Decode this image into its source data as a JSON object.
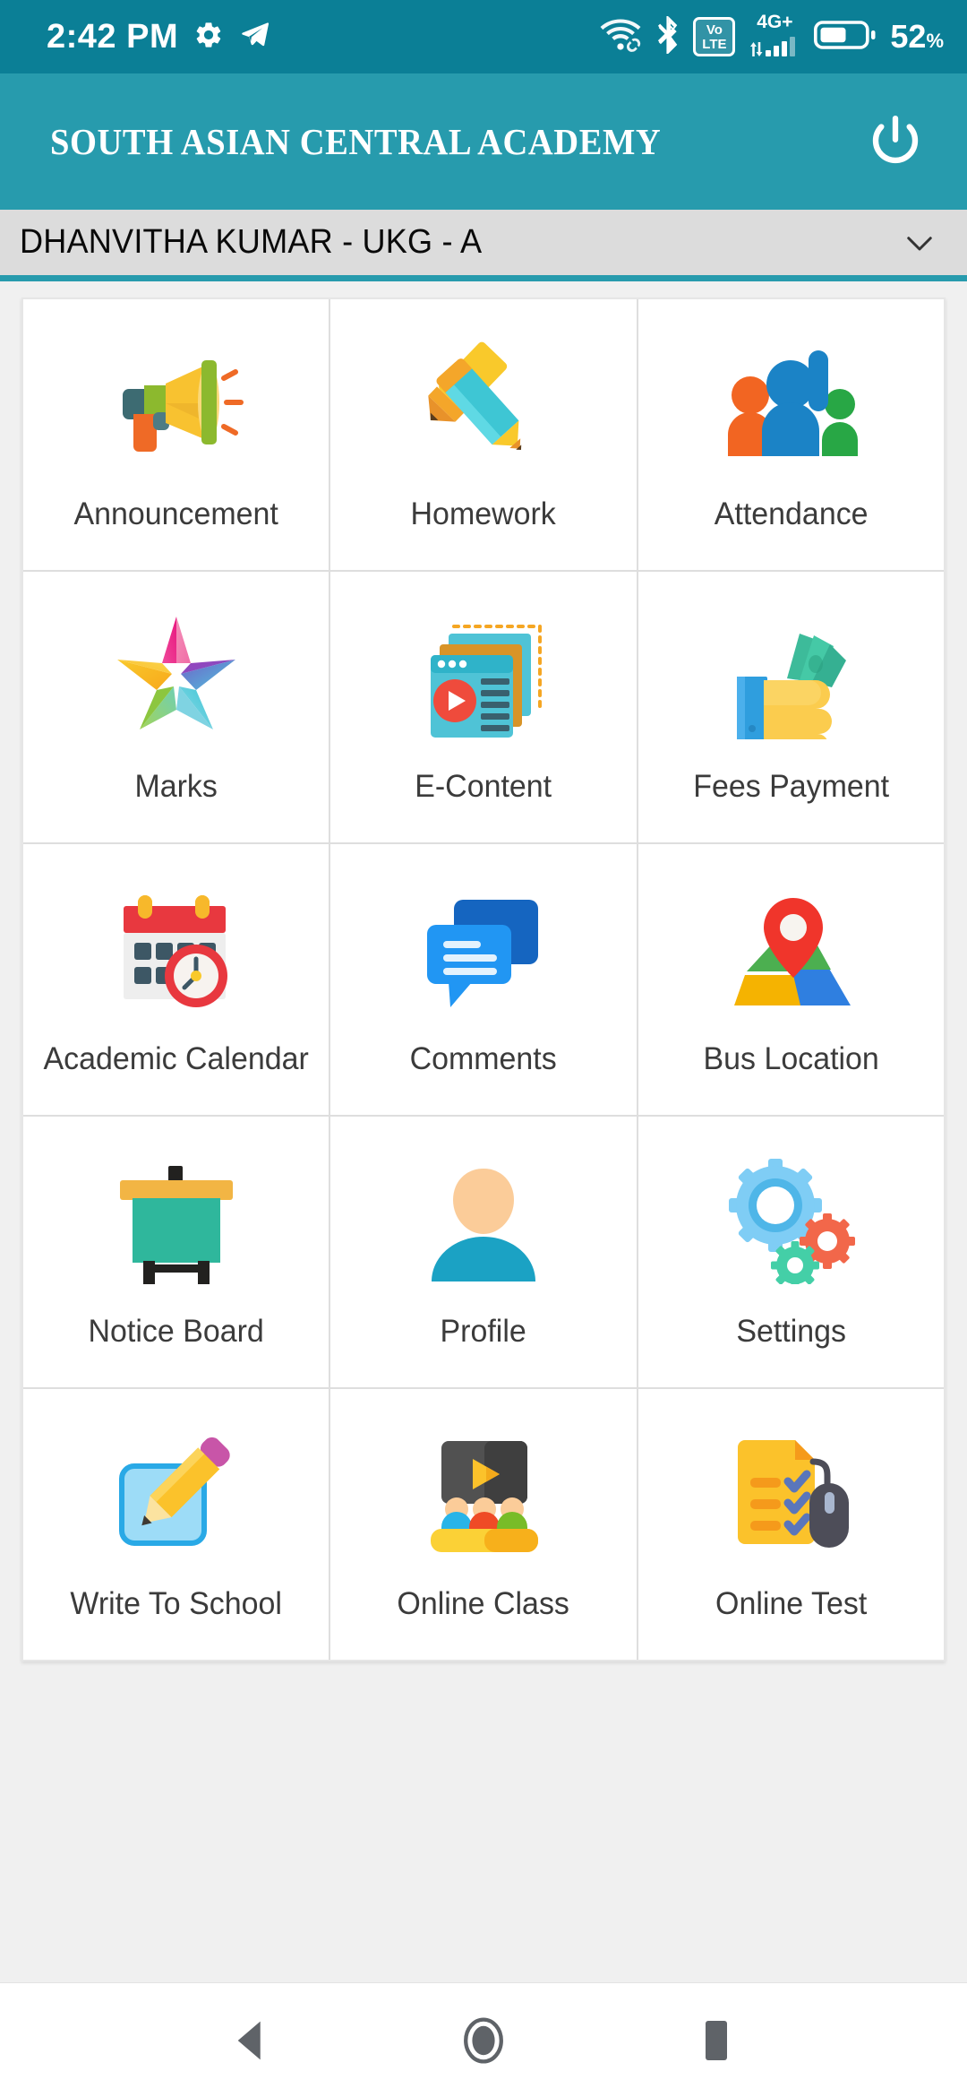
{
  "status_bar": {
    "time": "2:42 PM",
    "icons_left": [
      "gear-icon",
      "telegram-send-icon"
    ],
    "icons_right": [
      "wifi-icon",
      "wifi-link-icon",
      "bluetooth-icon",
      "volte-icon",
      "signal-icon",
      "battery-icon"
    ],
    "volte_top": "Vo",
    "volte_bottom": "LTE",
    "network_type": "4G+",
    "battery_percent": "52",
    "battery_unit": "%",
    "background_color": "#0b7f96"
  },
  "app_bar": {
    "title": "SOUTH ASIAN CENTRAL ACADEMY",
    "logout_icon": "power-icon",
    "background_color": "#279BAD",
    "text_color": "#ffffff"
  },
  "student_selector": {
    "selected": "DHANVITHA KUMAR - UKG - A",
    "dropdown_icon": "chevron-down-icon",
    "background_color": "#dcdcdc",
    "accent_color": "#279BAD"
  },
  "grid": {
    "columns": 3,
    "tiles": [
      {
        "label": "Announcement",
        "icon": "megaphone-icon"
      },
      {
        "label": "Homework",
        "icon": "pencil-ruler-icon"
      },
      {
        "label": "Attendance",
        "icon": "people-raised-hand-icon"
      },
      {
        "label": "Marks",
        "icon": "colorful-star-icon"
      },
      {
        "label": "E-Content",
        "icon": "media-windows-icon"
      },
      {
        "label": "Fees Payment",
        "icon": "hand-cash-icon"
      },
      {
        "label": "Academic Calendar",
        "icon": "calendar-clock-icon"
      },
      {
        "label": "Comments",
        "icon": "speech-bubbles-icon"
      },
      {
        "label": "Bus Location",
        "icon": "map-pin-icon"
      },
      {
        "label": "Notice Board",
        "icon": "board-easel-icon"
      },
      {
        "label": "Profile",
        "icon": "person-avatar-icon"
      },
      {
        "label": "Settings",
        "icon": "gears-icon"
      },
      {
        "label": "Write To School",
        "icon": "note-pencil-icon"
      },
      {
        "label": "Online Class",
        "icon": "classroom-video-icon"
      },
      {
        "label": "Online Test",
        "icon": "test-mouse-icon"
      }
    ]
  },
  "navigation_bar": {
    "back": "back-triangle-icon",
    "home": "home-circle-icon",
    "recents": "recents-square-icon",
    "icon_color": "#5f6368"
  }
}
